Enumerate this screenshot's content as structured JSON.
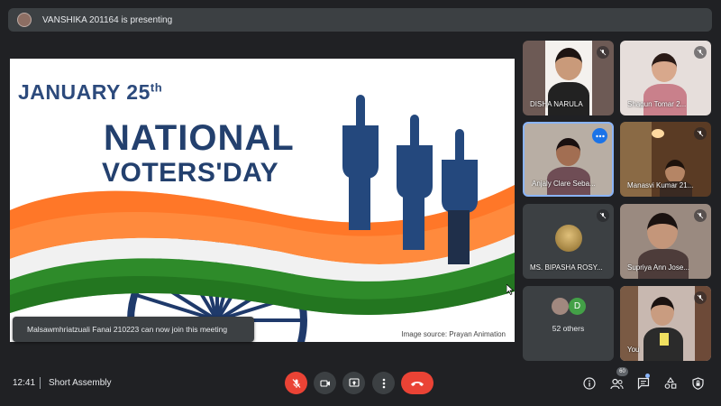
{
  "presenter_banner": {
    "text": "VANSHIKA 201164 is presenting"
  },
  "slide": {
    "date": "JANUARY 25",
    "date_sup": "th",
    "title_line1": "NATIONAL",
    "title_line2": "VOTERS'DAY",
    "credit": "Image source: Prayan Animation"
  },
  "toast": {
    "text": "Malsawmhriatzuali Fanai 210223 can now join this meeting"
  },
  "participants": [
    {
      "name": "DISHA NARULA"
    },
    {
      "name": "Shagun Tomar 2..."
    },
    {
      "name": "Anjaly Clare Seba..."
    },
    {
      "name": "Manasvi Kumar 21..."
    },
    {
      "name": "MS. BIPASHA ROSY..."
    },
    {
      "name": "Supriya Ann Jose..."
    },
    {
      "name": "52 others",
      "avatar_letter": "D"
    },
    {
      "name": "You"
    }
  ],
  "bottom_bar": {
    "time": "12:41",
    "meeting_title": "Short Assembly",
    "people_count": "60"
  },
  "colors": {
    "end_call": "#ea4335",
    "mic_off": "#ea4335",
    "accent": "#8ab4f8"
  }
}
